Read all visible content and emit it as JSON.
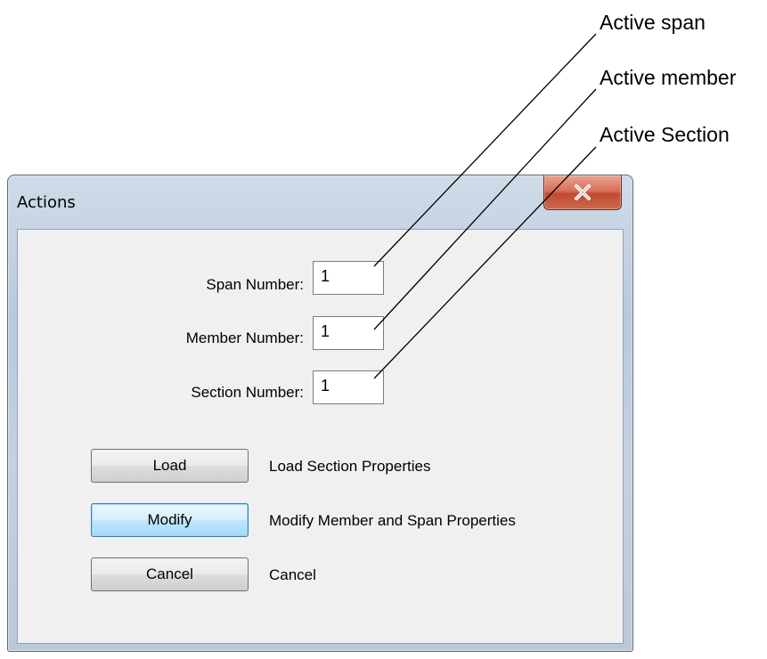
{
  "annotations": {
    "active_span": "Active span",
    "active_member": "Active member",
    "active_section": "Active Section"
  },
  "dialog": {
    "title": "Actions",
    "close_icon": "close-x-icon",
    "fields": {
      "span": {
        "label": "Span Number:",
        "value": "1"
      },
      "member": {
        "label": "Member Number:",
        "value": "1"
      },
      "section": {
        "label": "Section Number:",
        "value": "1"
      }
    },
    "actions": {
      "load": {
        "label": "Load",
        "description": "Load Section Properties"
      },
      "modify": {
        "label": "Modify",
        "description": "Modify Member and Span Properties"
      },
      "cancel": {
        "label": "Cancel",
        "description": "Cancel"
      }
    }
  },
  "colors": {
    "close_button": "#c14a31",
    "focus_border": "#3c7fb1"
  }
}
